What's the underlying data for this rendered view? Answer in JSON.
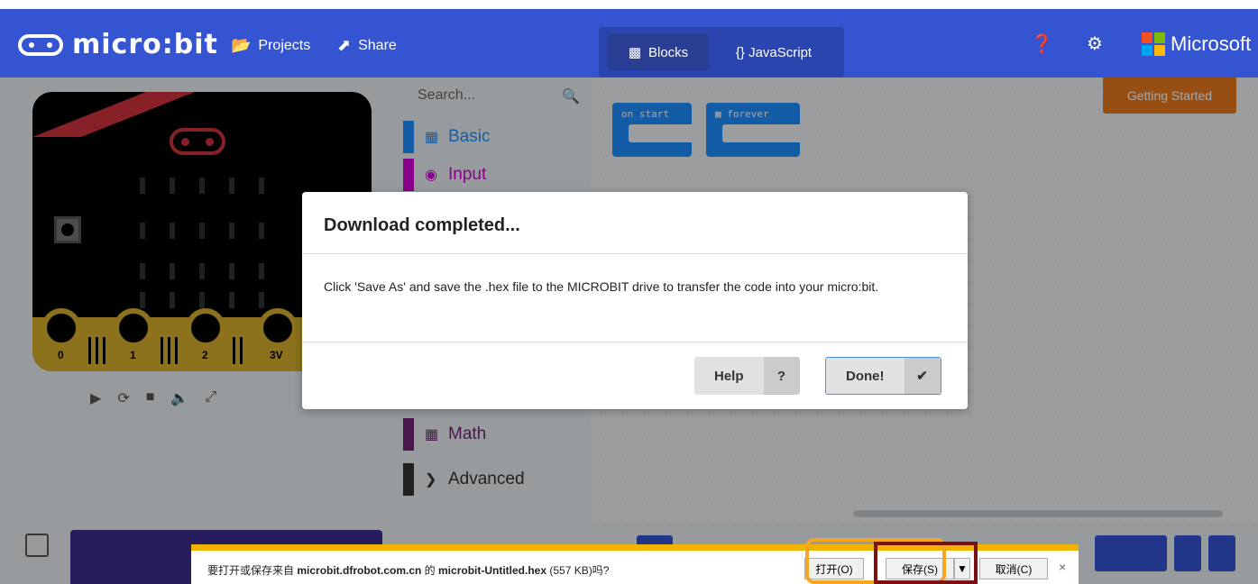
{
  "header": {
    "logo_text": "micro:bit",
    "projects_label": "Projects",
    "share_label": "Share",
    "blocks_label": "Blocks",
    "javascript_label": "{} JavaScript",
    "microsoft_label": "Microsoft"
  },
  "simulator": {
    "pins": [
      "0",
      "1",
      "2",
      "3V"
    ]
  },
  "toolbox": {
    "search_placeholder": "Search...",
    "categories": [
      {
        "label": "Basic",
        "color": "#1e90ff",
        "icon": "grid-icon"
      },
      {
        "label": "Input",
        "color": "#d400d4",
        "icon": "target-icon"
      },
      {
        "label": "Math",
        "color": "#712672",
        "icon": "calculator-icon"
      },
      {
        "label": "Advanced",
        "color": "#333333",
        "icon": "chevron-down-icon"
      }
    ]
  },
  "workspace": {
    "on_start_label": "on start",
    "forever_label": "forever",
    "getting_started_label": "Getting Started"
  },
  "dialog": {
    "title": "Download completed...",
    "message": "Click 'Save As' and save the .hex file to the MICROBIT drive to transfer the code into your micro:bit.",
    "help_label": "Help",
    "help_icon": "?",
    "done_label": "Done!",
    "done_icon": "✔"
  },
  "download_bar": {
    "prompt_prefix": "要打开或保存来自 ",
    "site": "microbit.dfrobot.com.cn",
    "prompt_mid": " 的 ",
    "filename": "microbit-Untitled.hex",
    "size": " (557 KB)吗?",
    "open_label": "打开(O)",
    "save_label": "保存(S)",
    "cancel_label": "取消(C)",
    "close_label": "×"
  },
  "colors": {
    "header": "#3454d1",
    "accent_orange": "#e6791e",
    "highlight_orange": "#f5a623",
    "highlight_red": "#7b1010",
    "download_bar_accent": "#f0b400"
  }
}
